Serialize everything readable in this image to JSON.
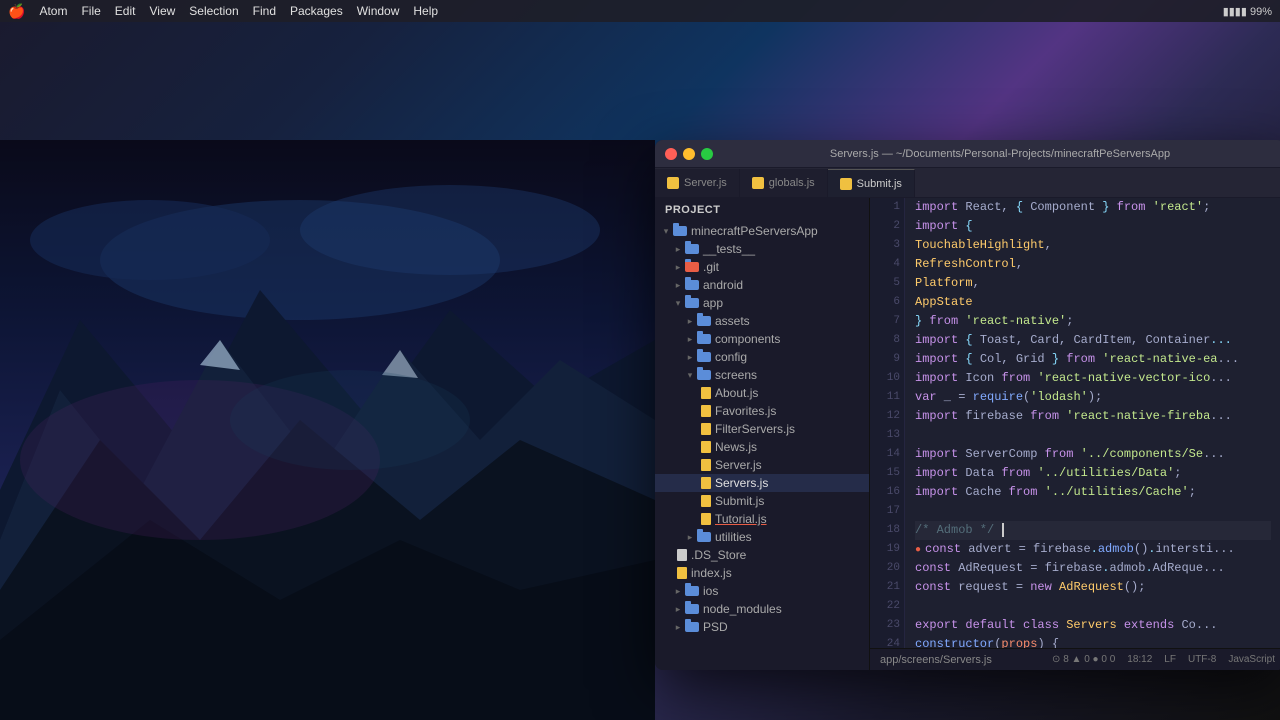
{
  "bg": {
    "gradient_desc": "dark blue mountain landscape"
  },
  "menubar": {
    "apple": "🍎",
    "items": [
      "Atom",
      "File",
      "Edit",
      "View",
      "Selection",
      "Find",
      "Packages",
      "Window",
      "Help"
    ],
    "right_items": [
      "99%"
    ]
  },
  "window": {
    "title": "Servers.js — ~/Documents/Personal-Projects/minecraftPeServersApp",
    "tabs": [
      {
        "label": "Server.js",
        "active": false
      },
      {
        "label": "globals.js",
        "active": false
      },
      {
        "label": "Submit.js",
        "active": false
      }
    ]
  },
  "filetree": {
    "header": "Project",
    "items": [
      {
        "indent": 0,
        "type": "folder",
        "label": "minecraftPeServersApp",
        "open": true
      },
      {
        "indent": 1,
        "type": "folder",
        "label": "__tests__",
        "open": false
      },
      {
        "indent": 1,
        "type": "folder-git",
        "label": ".git",
        "open": false
      },
      {
        "indent": 1,
        "type": "folder",
        "label": "android",
        "open": false
      },
      {
        "indent": 1,
        "type": "folder",
        "label": "app",
        "open": true
      },
      {
        "indent": 2,
        "type": "folder",
        "label": "assets",
        "open": false
      },
      {
        "indent": 2,
        "type": "folder",
        "label": "components",
        "open": false
      },
      {
        "indent": 2,
        "type": "folder",
        "label": "config",
        "open": false
      },
      {
        "indent": 2,
        "type": "folder",
        "label": "screens",
        "open": true
      },
      {
        "indent": 3,
        "type": "file-js",
        "label": "About.js"
      },
      {
        "indent": 3,
        "type": "file-js",
        "label": "Favorites.js"
      },
      {
        "indent": 3,
        "type": "file-js",
        "label": "FilterServers.js"
      },
      {
        "indent": 3,
        "type": "file-js",
        "label": "News.js"
      },
      {
        "indent": 3,
        "type": "file-js",
        "label": "Server.js"
      },
      {
        "indent": 3,
        "type": "file-js",
        "label": "Servers.js",
        "active": true
      },
      {
        "indent": 3,
        "type": "file-js",
        "label": "Submit.js"
      },
      {
        "indent": 3,
        "type": "file-js",
        "label": "Tutorial.js",
        "underline": true
      },
      {
        "indent": 2,
        "type": "folder",
        "label": "utilities",
        "open": false
      },
      {
        "indent": 1,
        "type": "file",
        "label": ".DS_Store"
      },
      {
        "indent": 1,
        "type": "file-js",
        "label": "index.js"
      },
      {
        "indent": 1,
        "type": "folder",
        "label": "ios",
        "open": false
      },
      {
        "indent": 1,
        "type": "folder",
        "label": "node_modules",
        "open": false
      },
      {
        "indent": 1,
        "type": "folder",
        "label": "PSD",
        "open": false
      }
    ]
  },
  "code": {
    "lines": [
      {
        "num": 1,
        "text": "import React, { Component } from 'react';"
      },
      {
        "num": 2,
        "text": "import {"
      },
      {
        "num": 3,
        "text": "    TouchableHighlight,"
      },
      {
        "num": 4,
        "text": "    RefreshControl,"
      },
      {
        "num": 5,
        "text": "    Platform,"
      },
      {
        "num": 6,
        "text": "    AppState"
      },
      {
        "num": 7,
        "text": "} from 'react-native';"
      },
      {
        "num": 8,
        "text": "import { Toast, Card, CardItem, Container..."
      },
      {
        "num": 9,
        "text": "import { Col, Grid } from 'react-native-ea..."
      },
      {
        "num": 10,
        "text": "import Icon from 'react-native-vector-ico..."
      },
      {
        "num": 11,
        "text": "var _ = require('lodash');"
      },
      {
        "num": 12,
        "text": "import firebase from 'react-native-fireba..."
      },
      {
        "num": 13,
        "text": ""
      },
      {
        "num": 14,
        "text": "import ServerComp from '../components/Se..."
      },
      {
        "num": 15,
        "text": "import Data from '../utilities/Data';"
      },
      {
        "num": 16,
        "text": "import Cache from '../utilities/Cache';"
      },
      {
        "num": 17,
        "text": ""
      },
      {
        "num": 18,
        "text": "/* Admob */"
      },
      {
        "num": 19,
        "text": "const advert = firebase.admob().intersti..."
      },
      {
        "num": 20,
        "text": "const AdRequest = firebase.admob.AdReque..."
      },
      {
        "num": 21,
        "text": "const request = new AdRequest();"
      },
      {
        "num": 22,
        "text": ""
      },
      {
        "num": 23,
        "text": "export default class Servers extends Co..."
      },
      {
        "num": 24,
        "text": "    constructor(props) {"
      }
    ]
  },
  "statusbar": {
    "left": "app/screens/Servers.js",
    "warnings": "⊙ 8  ▲ 0  ● 0  0",
    "position": "18:12",
    "encoding": "UTF-8",
    "lang": "JavaScript",
    "eol": "LF"
  }
}
